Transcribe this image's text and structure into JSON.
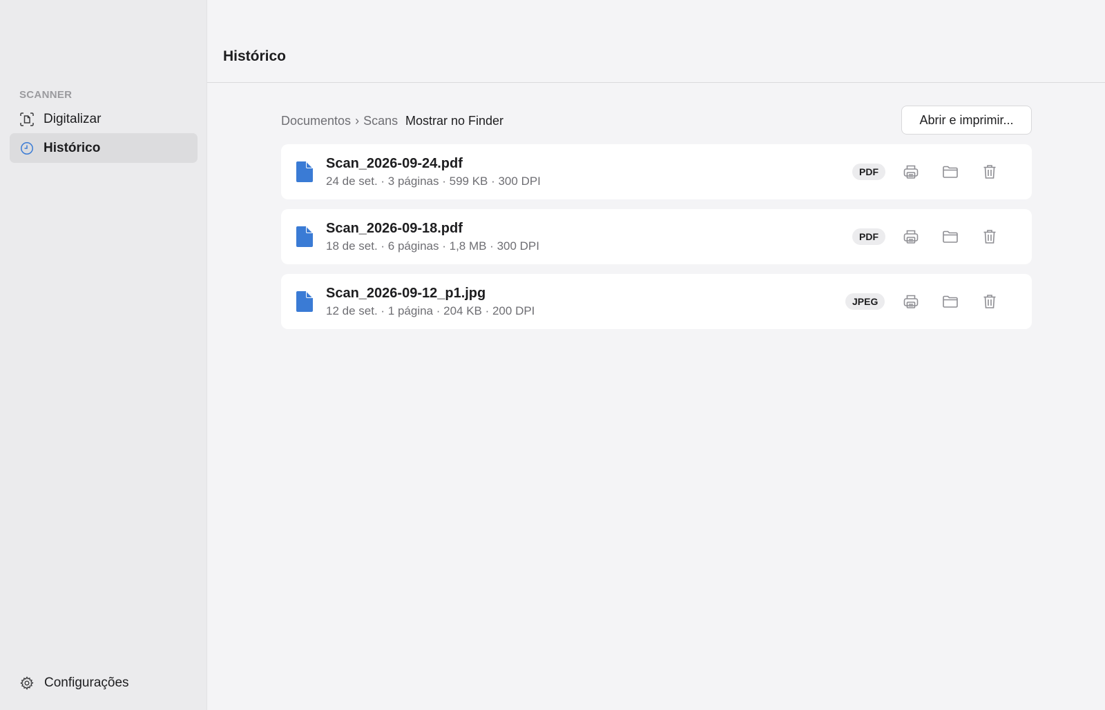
{
  "sidebar": {
    "section_label": "SCANNER",
    "items": [
      {
        "label": "Digitalizar",
        "icon": "scan-document-icon",
        "active": false
      },
      {
        "label": "Histórico",
        "icon": "clock-icon",
        "active": true
      }
    ],
    "settings_label": "Configurações",
    "settings_icon": "gear-icon"
  },
  "header": {
    "title": "Histórico"
  },
  "toolbar": {
    "breadcrumb": [
      "Documentos",
      "Scans"
    ],
    "breadcrumb_separator": "›",
    "show_in_finder": "Mostrar no Finder",
    "open_print_label": "Abrir e imprimir..."
  },
  "files": [
    {
      "name": "Scan_2026-09-24.pdf",
      "meta": "24 de set. · 3 páginas · 599 KB · 300 DPI",
      "format": "PDF"
    },
    {
      "name": "Scan_2026-09-18.pdf",
      "meta": "18 de set. · 6 páginas · 1,8 MB · 300 DPI",
      "format": "PDF"
    },
    {
      "name": "Scan_2026-09-12_p1.jpg",
      "meta": "12 de set. · 1 página · 204 KB · 200 DPI",
      "format": "JPEG"
    }
  ],
  "colors": {
    "accent": "#3a7bd5",
    "sidebar_bg": "#ebebed",
    "content_bg": "#f4f4f6",
    "icon_gray": "#8e8e93"
  }
}
